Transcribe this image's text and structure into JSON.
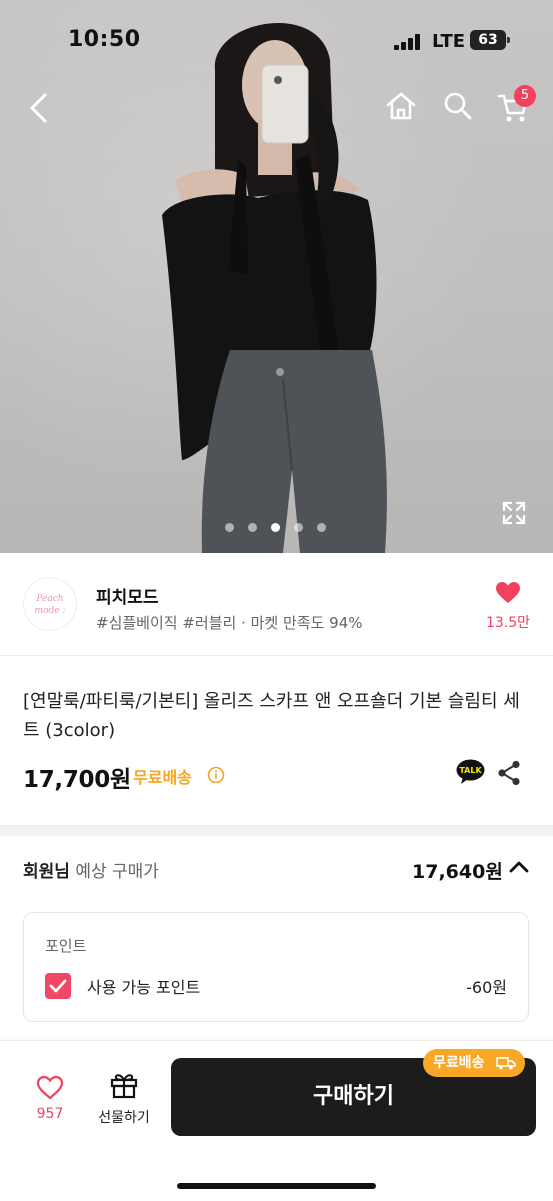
{
  "status_bar": {
    "time": "10:50",
    "network": "LTE",
    "battery": "63"
  },
  "nav": {
    "cart_badge": "5"
  },
  "gallery": {
    "total_images": 5,
    "active_index": 3
  },
  "shop": {
    "logo_text_line1": "Peach",
    "logo_text_line2": "mode :",
    "name": "피치모드",
    "tags": "#심플베이직 #러블리 · 마켓 만족도 94%",
    "likes": "13.5만"
  },
  "product": {
    "title": "[연말룩/파티룩/기본티] 올리즈 스카프 앤 오프숄더 기본 슬림티 세트 (3color)",
    "price": "17,700원",
    "shipping": "무료배송",
    "talk_label": "TALK"
  },
  "member_price": {
    "label_bold": "회원님",
    "label_rest": " 예상 구매가",
    "value": "17,640원"
  },
  "points": {
    "title": "포인트",
    "use_label": "사용 가능 포인트",
    "use_value": "-60원",
    "checked": true
  },
  "bottom_bar": {
    "like_count": "957",
    "gift_label": "선물하기",
    "buy_label": "구매하기",
    "free_shipping_tag": "무료배송"
  },
  "colors": {
    "accent_pink": "#f0425f",
    "shipping_orange": "#f5a623",
    "buy_button": "#1c1c1c"
  }
}
